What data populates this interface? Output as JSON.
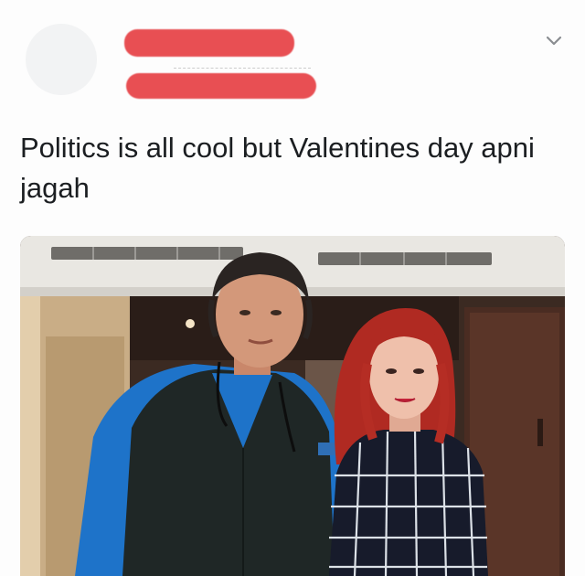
{
  "post": {
    "text": "Politics is all cool but Valentines day apni jagah",
    "redaction_color": "#e84f53",
    "icons": {
      "menu": "chevron-down-icon"
    },
    "photo": {
      "kind": "photograph"
    }
  }
}
